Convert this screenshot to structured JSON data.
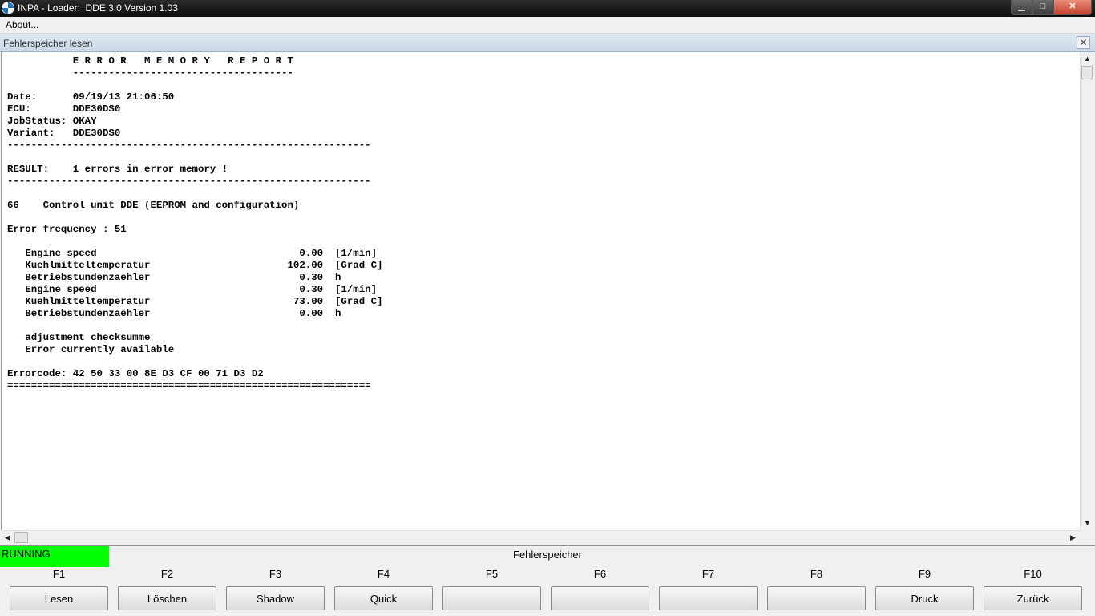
{
  "window": {
    "title": "INPA - Loader:  DDE 3.0 Version 1.03",
    "min_glyph": "▁",
    "max_glyph": "□",
    "close_glyph": "✕"
  },
  "menu": {
    "about": "About..."
  },
  "child": {
    "title": "Fehlerspeicher lesen",
    "close_glyph": "✕"
  },
  "report": {
    "lines": [
      "           E R R O R   M E M O R Y   R E P O R T",
      "           -------------------------------------",
      "",
      "Date:      09/19/13 21:06:50",
      "ECU:       DDE30DS0",
      "JobStatus: OKAY",
      "Variant:   DDE30DS0",
      "-------------------------------------------------------------",
      "",
      "RESULT:    1 errors in error memory !",
      "-------------------------------------------------------------",
      "",
      "66    Control unit DDE (EEPROM and configuration)",
      "",
      "Error frequency : 51",
      "",
      "   Engine speed                                  0.00  [1/min]",
      "   Kuehlmitteltemperatur                       102.00  [Grad C]",
      "   Betriebstundenzaehler                         0.30  h",
      "   Engine speed                                  0.30  [1/min]",
      "   Kuehlmitteltemperatur                        73.00  [Grad C]",
      "   Betriebstundenzaehler                         0.00  h",
      "",
      "   adjustment checksumme",
      "   Error currently available",
      "",
      "Errorcode: 42 50 33 00 8E D3 CF 00 71 D3 D2",
      "============================================================="
    ]
  },
  "scroll": {
    "up": "▲",
    "down": "▼",
    "left": "◀",
    "right": "▶"
  },
  "status": {
    "state": "RUNNING",
    "title": "Fehlerspeicher"
  },
  "fkeys": [
    {
      "key": "F1",
      "label": "Lesen"
    },
    {
      "key": "F2",
      "label": "Löschen"
    },
    {
      "key": "F3",
      "label": "Shadow"
    },
    {
      "key": "F4",
      "label": "Quick"
    },
    {
      "key": "F5",
      "label": ""
    },
    {
      "key": "F6",
      "label": ""
    },
    {
      "key": "F7",
      "label": ""
    },
    {
      "key": "F8",
      "label": ""
    },
    {
      "key": "F9",
      "label": "Druck"
    },
    {
      "key": "F10",
      "label": "Zurück"
    }
  ],
  "colors": {
    "running": "#00ff00",
    "titlebar": "#1a1a1a",
    "report_bg": "#ffffff"
  }
}
